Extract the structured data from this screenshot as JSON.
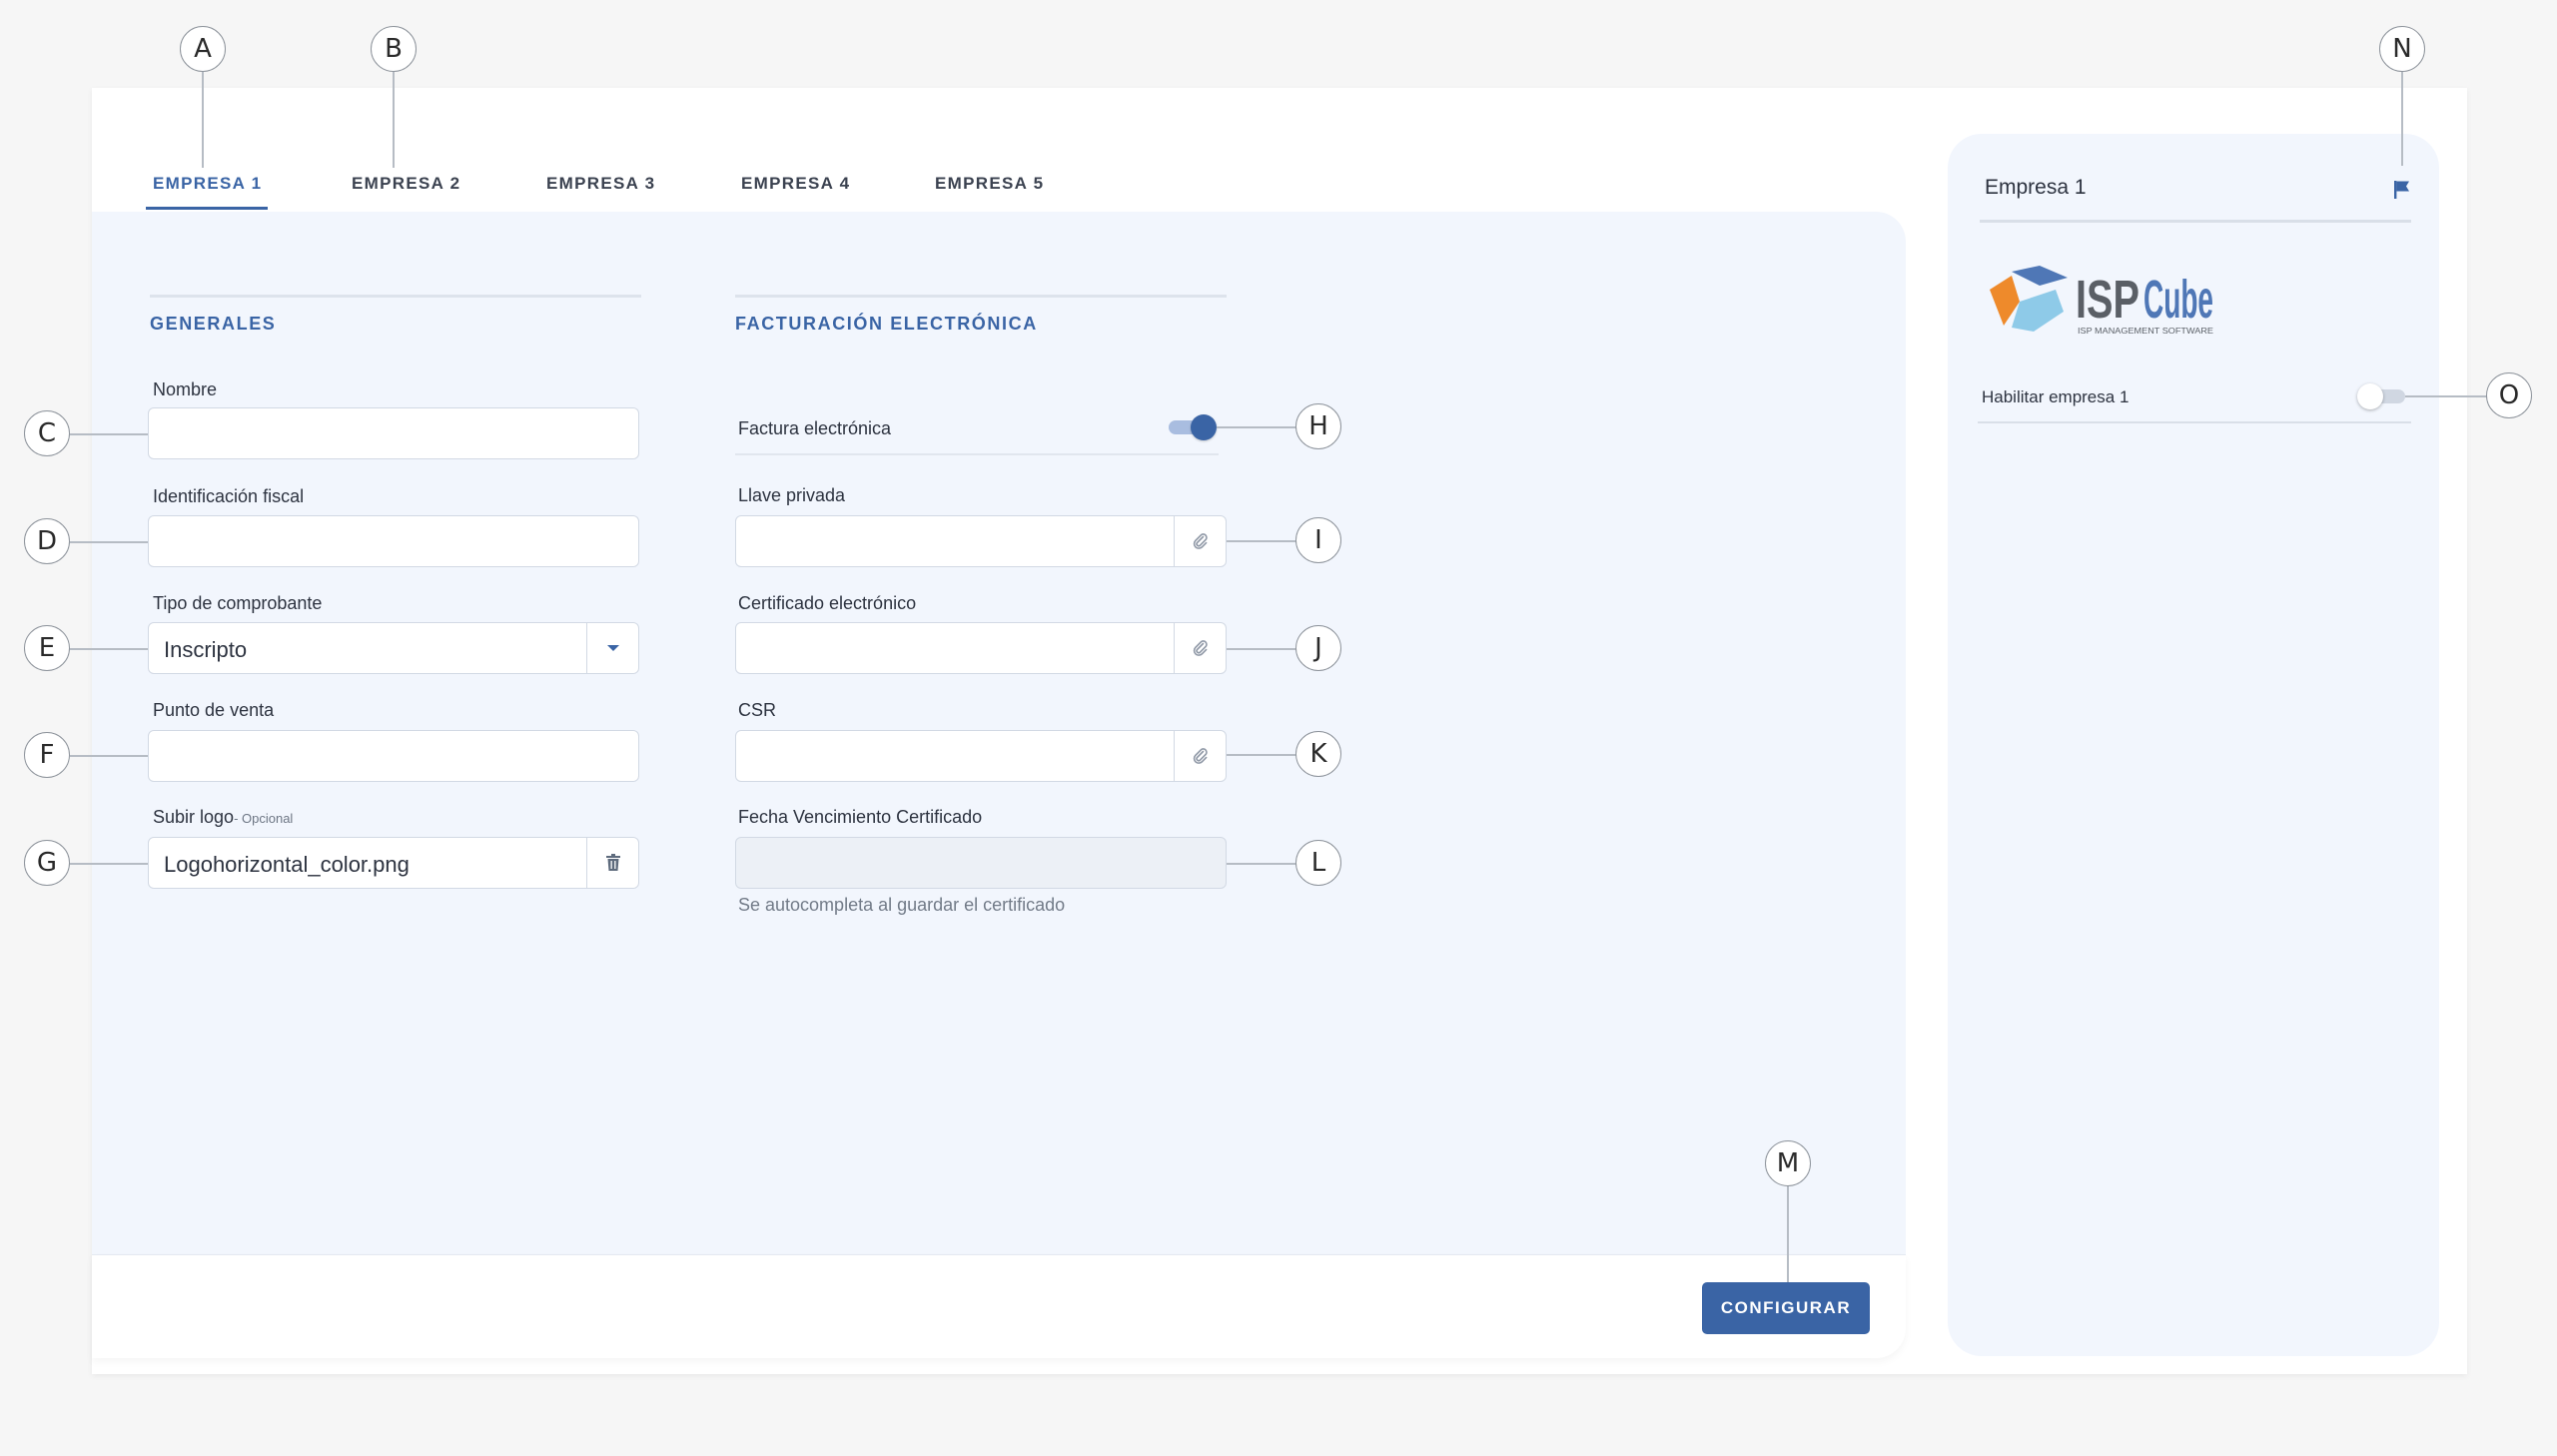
{
  "tabs": [
    {
      "label": "EMPRESA 1",
      "active": true
    },
    {
      "label": "EMPRESA 2",
      "active": false
    },
    {
      "label": "EMPRESA 3",
      "active": false
    },
    {
      "label": "EMPRESA 4",
      "active": false
    },
    {
      "label": "EMPRESA 5",
      "active": false
    }
  ],
  "generales": {
    "title": "GENERALES",
    "nombre": {
      "label": "Nombre",
      "value": ""
    },
    "identificacion_fiscal": {
      "label": "Identificación fiscal",
      "value": ""
    },
    "tipo_comprobante": {
      "label": "Tipo de comprobante",
      "value": "Inscripto",
      "icon": "chevron-down-icon"
    },
    "punto_venta": {
      "label": "Punto de venta",
      "value": ""
    },
    "subir_logo": {
      "label": "Subir logo",
      "optional": "- Opcional",
      "value": "Logohorizontal_color.png",
      "icon": "trash-icon"
    }
  },
  "facturacion": {
    "title": "FACTURACIÓN ELECTRÓNICA",
    "factura_electronica": {
      "label": "Factura electrónica",
      "enabled": true
    },
    "llave_privada": {
      "label": "Llave privada",
      "value": "",
      "icon": "paperclip-icon"
    },
    "certificado": {
      "label": "Certificado electrónico",
      "value": "",
      "icon": "paperclip-icon"
    },
    "csr": {
      "label": "CSR",
      "value": "",
      "icon": "paperclip-icon"
    },
    "fecha_vencimiento": {
      "label": "Fecha Vencimiento Certificado",
      "value": "",
      "hint": "Se autocompleta al guardar el certificado"
    }
  },
  "footer": {
    "configure_label": "CONFIGURAR"
  },
  "side": {
    "title": "Empresa 1",
    "flag_icon": "flag-icon",
    "logo_text": "ISPCUBE",
    "logo_subtitle": "ISP MANAGEMENT SOFTWARE",
    "habilitar_label": "Habilitar empresa 1",
    "habilitar_enabled": false
  },
  "callouts": [
    "A",
    "B",
    "C",
    "D",
    "E",
    "F",
    "G",
    "H",
    "I",
    "J",
    "K",
    "L",
    "M",
    "N",
    "O"
  ],
  "colors": {
    "accent": "#3a64a5",
    "panel": "#f2f6fd",
    "logo_orange": "#ee8a2b",
    "logo_blue": "#4f77b6",
    "logo_light_blue": "#8ecae8"
  }
}
